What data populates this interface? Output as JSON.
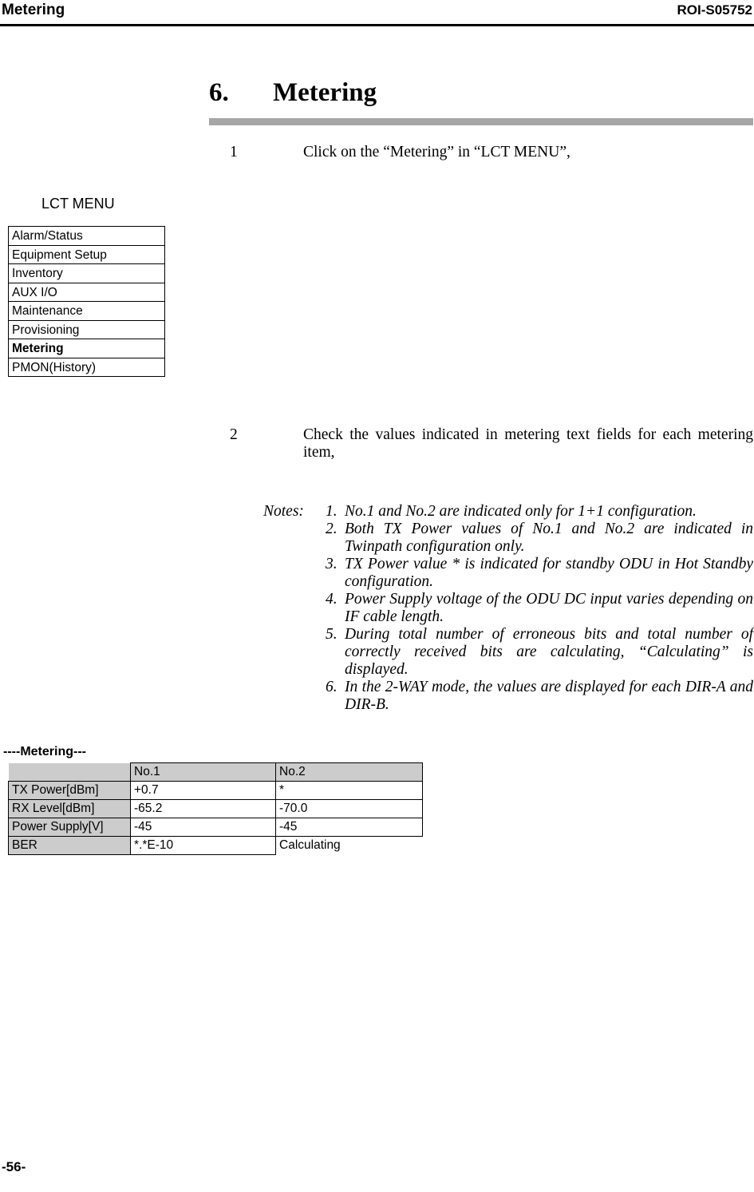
{
  "header": {
    "title": "Metering",
    "code": "ROI-S05752"
  },
  "chapter": {
    "number": "6.",
    "name": "Metering"
  },
  "steps": [
    {
      "num": "1",
      "text": "Click on the “Metering” in “LCT MENU”,"
    },
    {
      "num": "2",
      "text": "Check the values indicated in metering text fields for each metering item,"
    }
  ],
  "lct_menu": {
    "label": "LCT MENU",
    "items": [
      {
        "label": "Alarm/Status",
        "selected": false
      },
      {
        "label": "Equipment Setup",
        "selected": false
      },
      {
        "label": "Inventory",
        "selected": false
      },
      {
        "label": "AUX I/O",
        "selected": false
      },
      {
        "label": "Maintenance",
        "selected": false
      },
      {
        "label": "Provisioning",
        "selected": false
      },
      {
        "label": "Metering",
        "selected": true
      },
      {
        "label": "PMON(History)",
        "selected": false
      }
    ]
  },
  "notes": {
    "label": "Notes:",
    "items": [
      {
        "num": "1.",
        "text": "No.1 and No.2 are indicated only for 1+1 configuration."
      },
      {
        "num": "2.",
        "text": "Both TX Power values of No.1 and No.2 are indicated in Twinpath configuration only."
      },
      {
        "num": "3.",
        "text": "TX Power value * is indicated for standby ODU in Hot Standby configuration."
      },
      {
        "num": "4.",
        "text": "Power Supply voltage of the ODU DC input varies depending on IF cable length."
      },
      {
        "num": "5.",
        "text": "During total number of erroneous bits and total number of correctly received bits are calculating, “Calculating” is displayed."
      },
      {
        "num": "6.",
        "text": "In the 2-WAY mode, the values are displayed for each DIR-A and DIR-B."
      }
    ]
  },
  "metering": {
    "caption": "----Metering---",
    "columns": [
      "",
      "No.1",
      "No.2"
    ],
    "rows": [
      {
        "label": "TX Power[dBm]",
        "no1": "+0.7",
        "no2": "*"
      },
      {
        "label": "RX Level[dBm]",
        "no1": "-65.2",
        "no2": "-70.0"
      },
      {
        "label": "Power Supply[V]",
        "no1": "-45",
        "no2": "-45"
      },
      {
        "label": "BER",
        "no1": "*.*E-10",
        "no2": "Calculating"
      }
    ]
  },
  "footer": {
    "page": "-56-"
  }
}
